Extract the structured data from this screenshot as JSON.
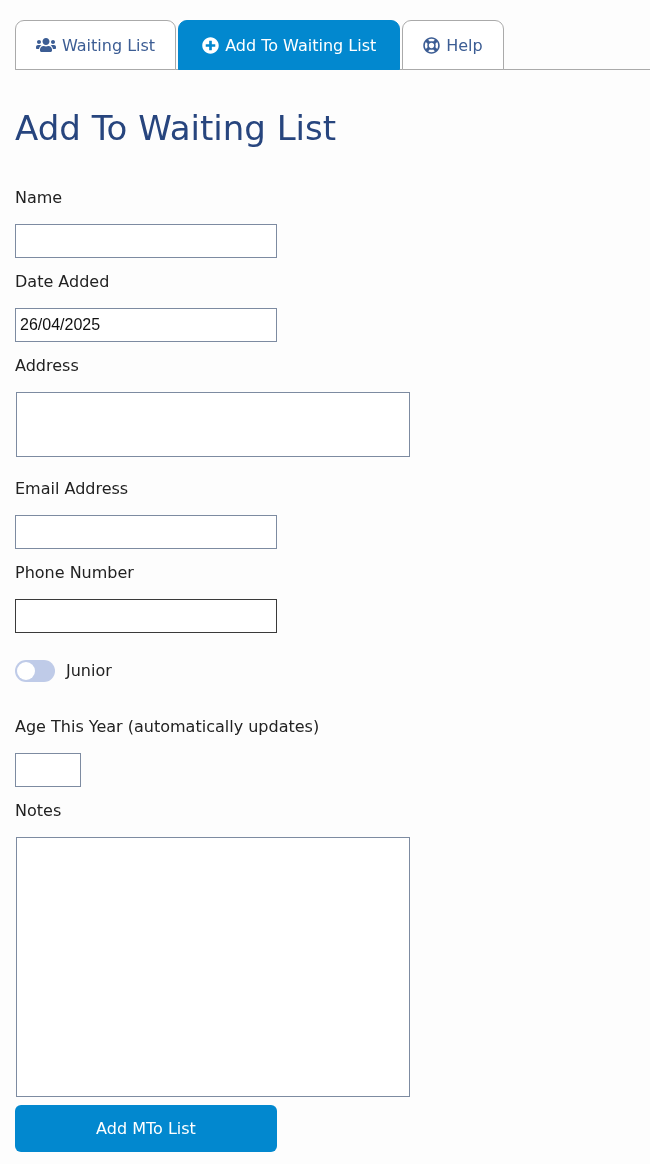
{
  "tabs": [
    {
      "label": "Waiting List",
      "selected": false
    },
    {
      "label": "Add To Waiting List",
      "selected": true
    },
    {
      "label": "Help",
      "selected": false
    }
  ],
  "heading": "Add To Waiting List",
  "fields": [
    {
      "kind": "text",
      "label": "Name",
      "focused": false
    },
    {
      "kind": "text",
      "label": "Date Added",
      "value": "26/04/2025",
      "focused": false
    },
    {
      "kind": "textarea",
      "label": "Address"
    },
    {
      "kind": "text",
      "label": "Email Address",
      "focused": false
    },
    {
      "kind": "text",
      "label": "Phone Number",
      "focused": true
    },
    {
      "kind": "toggle",
      "label": "Junior",
      "on": false
    },
    {
      "kind": "number",
      "label": "Age This Year (automatically updates)"
    },
    {
      "kind": "textarea",
      "label": "Notes"
    }
  ],
  "submit_button": "Add MTo List"
}
